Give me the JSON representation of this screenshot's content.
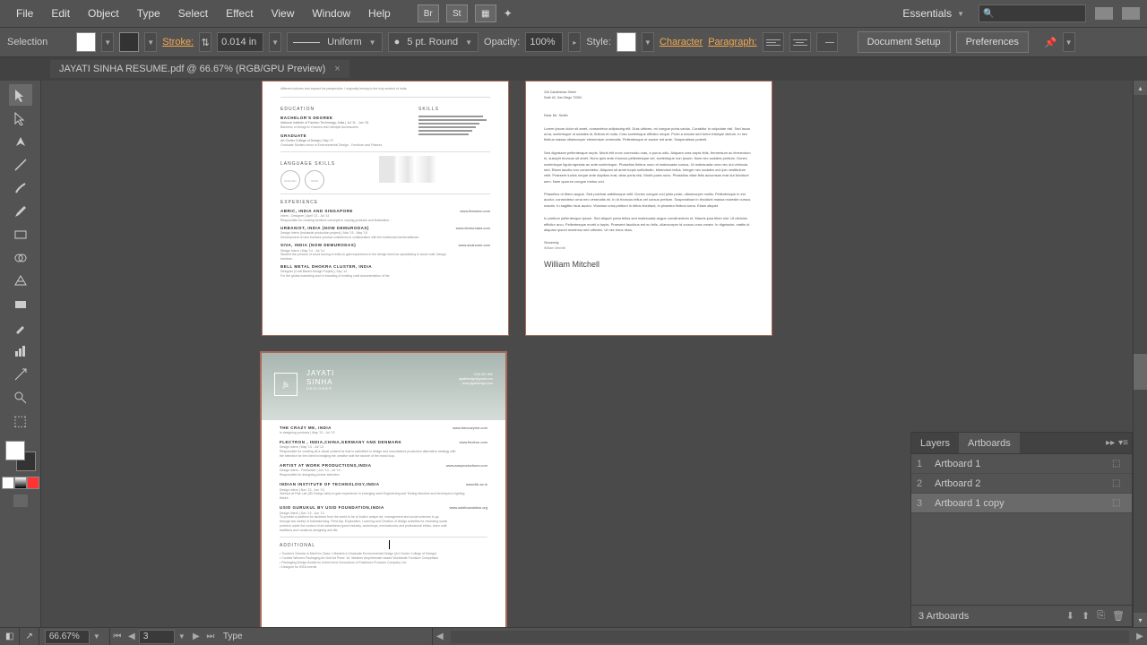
{
  "menu": [
    "File",
    "Edit",
    "Object",
    "Type",
    "Select",
    "Effect",
    "View",
    "Window",
    "Help"
  ],
  "workspace": "Essentials",
  "controlbar": {
    "mode": "Selection",
    "stroke_label": "Stroke:",
    "stroke_value": "0.014 in",
    "stroke_style": "Uniform",
    "brush": "5 pt. Round",
    "opacity_label": "Opacity:",
    "opacity_value": "100%",
    "style_label": "Style:",
    "character": "Character",
    "paragraph": "Paragraph:",
    "doc_setup": "Document Setup",
    "preferences": "Preferences"
  },
  "tab": {
    "title": "JAYATI SINHA RESUME.pdf @ 66.67% (RGB/GPU Preview)"
  },
  "artboard1": {
    "education_title": "EDUCATION",
    "bachelor": "BACHELOR'S DEGREE",
    "bachelor_sub": "National Institute of Fashion Technology, India | Jul '11 - Jun '15",
    "graduate": "GRADUATE",
    "graduate_sub": "Art Center College of Design | Sep '17",
    "skills_title": "SKILLS",
    "lang_title": "LANGUAGE SKILLS",
    "lang1": "ENGLISH",
    "lang2": "HINDI",
    "exp_title": "EXPERIENCE",
    "exp1": "ABRIC, INDIA AND SINGAPORE",
    "exp1_url": "www.theamoc.com",
    "exp2": "URBANIST, INDIA    (NOW DEMURODAS)",
    "exp2_url": "www.demurodas.com",
    "exp3": "SIVA, INDIA    (NOW DEMURODAS)",
    "exp3_url": "www.sivahome.com",
    "exp4": "BELL METAL DHOKRA CLUSTER, INDIA"
  },
  "artboard2": {
    "greeting": "Dear Mr. Smith",
    "closing": "Sincerely,",
    "signature": "William Mitchell"
  },
  "artboard3": {
    "name1": "JAYATI",
    "name2": "SINHA",
    "subtitle": "DESIGNER",
    "e1": "THE CRAZY ME, INDIA",
    "e1_url": "www.thecrazyme.com",
    "e2": "FLECTRON , INDIA,CHINA,GERMANY AND DENMARK",
    "e2_url": "www.flectron.com",
    "e3": "ARTIST AT WORK PRODUCTIONS,INDIA",
    "e3_url": "www.aawproductions.com",
    "e4": "INDIAN INSTITUTE OF TECHNOLOGY,INDIA",
    "e4_url": "www.iitk.ac.in",
    "e5": "USID GURUKUL BY USID FOUNDATION,INDIA",
    "e5_url": "www.usidfoundation.org",
    "additional": "ADDITIONAL"
  },
  "panel": {
    "tab1": "Layers",
    "tab2": "Artboards",
    "rows": [
      {
        "num": "1",
        "name": "Artboard 1"
      },
      {
        "num": "2",
        "name": "Artboard 2"
      },
      {
        "num": "3",
        "name": "Artboard 1 copy"
      }
    ],
    "footer": "3 Artboards"
  },
  "status": {
    "zoom": "66.67%",
    "artboard_num": "3",
    "type_label": "Type"
  }
}
